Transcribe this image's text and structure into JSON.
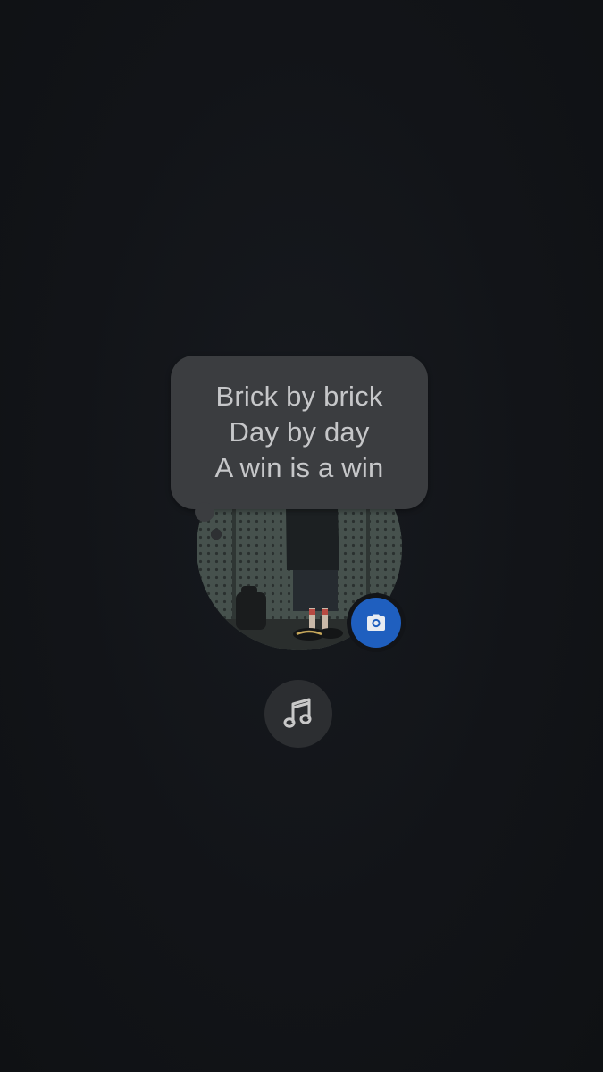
{
  "note": {
    "lines": [
      "Brick by brick",
      "Day by day",
      "A win is a win"
    ]
  },
  "icons": {
    "camera": "camera-icon",
    "music": "music-note-icon"
  },
  "colors": {
    "background": "#121418",
    "bubble": "#3b3d40",
    "note_text": "#c6c7c9",
    "camera_accent": "#1f5fbf",
    "music_button": "#2c2e31"
  }
}
